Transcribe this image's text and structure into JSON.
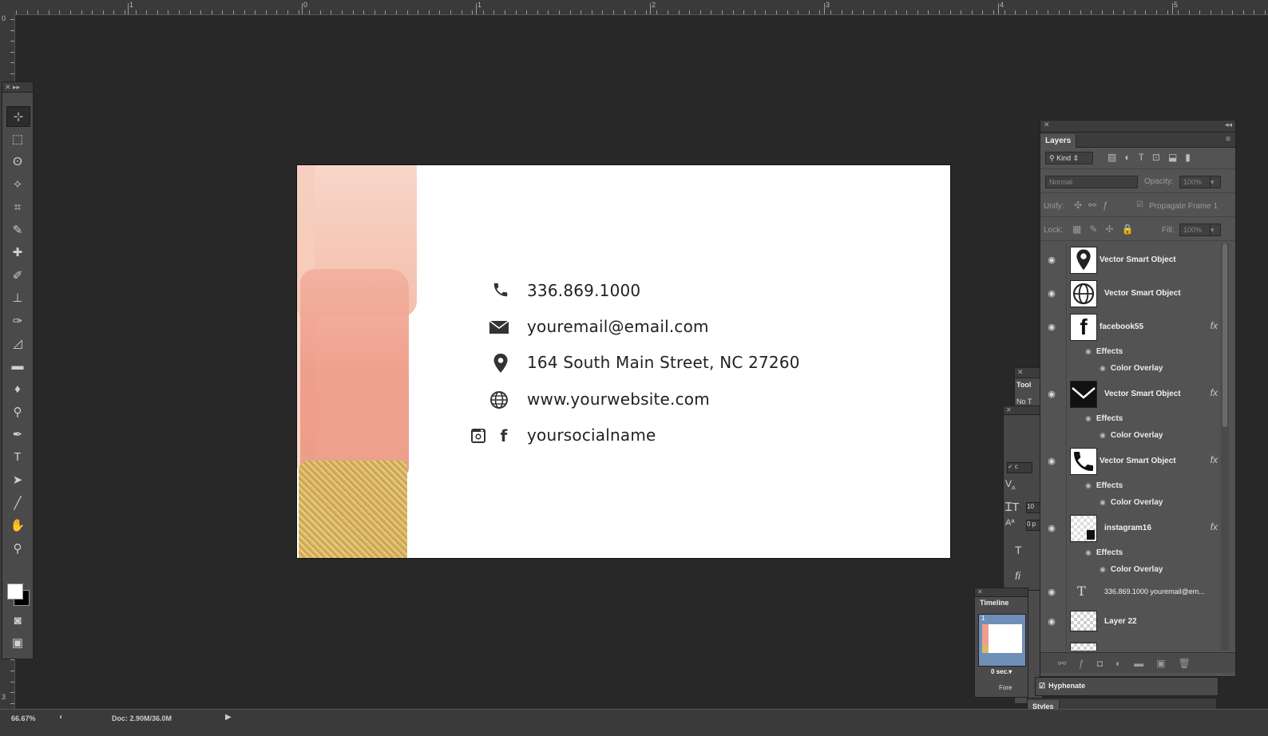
{
  "ruler": {
    "labels": [
      "1",
      "0",
      "1",
      "2",
      "3",
      "4",
      "5"
    ]
  },
  "ruler_left": {
    "labels": [
      "0",
      "3"
    ]
  },
  "tools": [
    {
      "icon": "move-tool-icon",
      "glyph": "⊹"
    },
    {
      "icon": "marquee-tool-icon",
      "glyph": "⬚"
    },
    {
      "icon": "lasso-tool-icon",
      "glyph": "ʘ"
    },
    {
      "icon": "magic-wand-tool-icon",
      "glyph": "✧"
    },
    {
      "icon": "crop-tool-icon",
      "glyph": "⌗"
    },
    {
      "icon": "eyedropper-tool-icon",
      "glyph": "✎"
    },
    {
      "icon": "healing-brush-tool-icon",
      "glyph": "✚"
    },
    {
      "icon": "brush-tool-icon",
      "glyph": "✐"
    },
    {
      "icon": "stamp-tool-icon",
      "glyph": "⊥"
    },
    {
      "icon": "history-brush-tool-icon",
      "glyph": "✑"
    },
    {
      "icon": "eraser-tool-icon",
      "glyph": "◿"
    },
    {
      "icon": "gradient-tool-icon",
      "glyph": "▬"
    },
    {
      "icon": "blur-tool-icon",
      "glyph": "♦"
    },
    {
      "icon": "dodge-tool-icon",
      "glyph": "⚲"
    },
    {
      "icon": "pen-tool-icon",
      "glyph": "✒"
    },
    {
      "icon": "type-tool-icon",
      "glyph": "T"
    },
    {
      "icon": "path-selection-tool-icon",
      "glyph": "➤"
    },
    {
      "icon": "line-tool-icon",
      "glyph": "╱"
    },
    {
      "icon": "hand-tool-icon",
      "glyph": "✋"
    },
    {
      "icon": "zoom-tool-icon",
      "glyph": "⚲"
    }
  ],
  "card": {
    "phone": "336.869.1000",
    "email": "youremail@email.com",
    "address": "164 South Main Street,  NC 27260",
    "website": "www.yourwebsite.com",
    "social": "yoursocialname"
  },
  "layers_panel": {
    "tab": "Layers",
    "filter_kind": "Kind",
    "blend_mode": "Normal",
    "opacity_label": "Opacity:",
    "opacity_value": "100%",
    "unify_label": "Unify:",
    "propagate_label": "Propagate Frame 1",
    "lock_label": "Lock:",
    "fill_label": "Fill:",
    "fill_value": "100%",
    "layers": [
      {
        "name": "Vector Smart Object",
        "thumb": "location-pin-icon",
        "fx": false
      },
      {
        "name": "Vector Smart Object",
        "thumb": "globe-icon",
        "fx": false
      },
      {
        "name": "facebook55",
        "thumb": "facebook-icon",
        "fx": true,
        "effects": "Effects",
        "overlay": "Color Overlay"
      },
      {
        "name": "Vector Smart Object",
        "thumb": "envelope-icon",
        "fx": true,
        "effects": "Effects",
        "overlay": "Color Overlay"
      },
      {
        "name": "Vector Smart Object",
        "thumb": "phone-icon",
        "fx": true,
        "effects": "Effects",
        "overlay": "Color Overlay"
      },
      {
        "name": "instagram16",
        "thumb": "instagram-icon",
        "fx": true,
        "effects": "Effects",
        "overlay": "Color Overlay"
      },
      {
        "name": "336.869.1000 youremail@em...",
        "thumb": "type-layer-icon",
        "fx": false
      },
      {
        "name": "Layer 22",
        "thumb": "transparent-thumb",
        "fx": false
      }
    ],
    "fx_glyph": "fx",
    "eye_glyph": "👁"
  },
  "side_panels": {
    "tools_tab": "Tool",
    "tools_sub": "No T",
    "timeline_tab": "Timeline",
    "frame_number": "1",
    "frame_delay": "0 sec.▾",
    "forever_label": "Fore",
    "hyphenate_label": "Hyphenate",
    "styles_tab": "Styles",
    "char_values": [
      "10",
      "0 p"
    ]
  },
  "status": {
    "zoom": "66.67%",
    "doc": "Doc: 2.90M/36.0M"
  },
  "colors": {
    "workspace": "#282828",
    "panel": "#535353",
    "peach_light": "#f5c9b8",
    "salmon": "#ef9f8c",
    "gold": "#d9b867",
    "ink": "#222222"
  }
}
